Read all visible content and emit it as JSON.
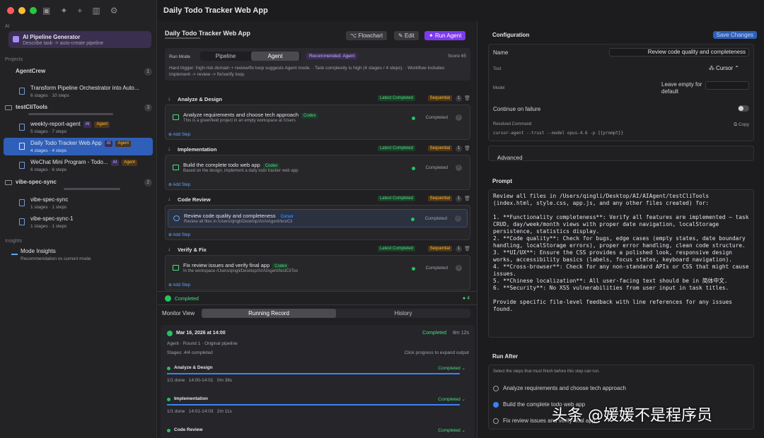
{
  "window": {
    "title": "Daily Todo Tracker Web App"
  },
  "sidebar": {
    "ai_label": "AI",
    "pipeline_generator": {
      "title": "AI Pipeline Generator",
      "subtitle": "Describe task -> auto-create pipeline"
    },
    "projects_label": "Projects",
    "groups": [
      {
        "name": "AgentCrew",
        "count": "1",
        "items": [
          {
            "title": "Transform Pipeline Orchestrator into Auto...",
            "meta": "6 stages · 10 steps"
          }
        ]
      },
      {
        "name": "testCliTools",
        "count": "3",
        "items": [
          {
            "title": "weekly-report-agent",
            "meta": "5 stages · 7 steps",
            "tags": [
              "AI",
              "Agent"
            ]
          },
          {
            "title": "Daily Todo Tracker Web App",
            "meta": "4 stages · 4 steps",
            "tags": [
              "AI",
              "Agent"
            ]
          },
          {
            "title": "WeChat Mini Program - Todo...",
            "meta": "6 stages · 6 steps",
            "tags": [
              "AI",
              "Agent"
            ]
          }
        ]
      },
      {
        "name": "vibe-spec-sync",
        "count": "2",
        "items": [
          {
            "title": "vibe-spec-sync",
            "meta": "1 stages · 1 steps"
          },
          {
            "title": "vibe-spec-sync-1",
            "meta": "1 stages · 1 steps"
          }
        ]
      }
    ],
    "insights_label": "Insights",
    "mode_insights": {
      "title": "Mode Insights",
      "subtitle": "Recommendation vs current mode"
    }
  },
  "center": {
    "title": "Daily Todo Tracker Web App",
    "buttons": {
      "flowchart": "Flowchart",
      "edit": "Edit",
      "run_agent": "Run Agent"
    },
    "run_mode": {
      "label": "Run Mode",
      "pipeline": "Pipeline",
      "agent": "Agent",
      "recommended": "Recommended: Agent",
      "score": "Score 65",
      "hint": "Hard trigger: high-risk domain + review/fix loop suggests Agent mode. · Task complexity is high (4 stages / 4 steps). · Workflow includes implement -> review -> fix/verify loop."
    },
    "stage_tags": {
      "latest": "Latest Completed",
      "sequential": "Sequential",
      "count": "1"
    },
    "add_step": "Add Step",
    "status_completed": "Completed",
    "stages": [
      {
        "name": "Analyze & Design",
        "step_title": "Analyze requirements and choose tech approach",
        "tool": "Codex",
        "desc": "This is a greenfield project in an empty workspace at /Users"
      },
      {
        "name": "Implementation",
        "step_title": "Build the complete todo web app",
        "tool": "Codex",
        "desc": "Based on the design, implement a daily todo tracker web app"
      },
      {
        "name": "Code Review",
        "step_title": "Review code quality and completeness",
        "tool": "Cursor",
        "desc": "Review all files in /Users/qingli/Desktop/AI/AIAgent/testCli"
      },
      {
        "name": "Verify & Fix",
        "step_title": "Fix review issues and verify final app",
        "tool": "Codex",
        "desc": "In the workspace /Users/qingli/Desktop/AI/AIAgent/testCliToo"
      }
    ],
    "summary": {
      "status": "Completed",
      "count": "4"
    },
    "monitor": {
      "label": "Monitor View",
      "tab_running": "Running Record",
      "tab_history": "History"
    },
    "record": {
      "date": "Mar 16, 2026 at 14:00",
      "status": "Completed",
      "duration": "8m 12s",
      "meta": "Agent · Round 1 · Original pipeline",
      "stages": "Stages: 4/4 completed",
      "expand_hint": "Click progress to expand output",
      "rows": [
        {
          "name": "Analyze & Design",
          "status": "Completed",
          "done": "1/1 done",
          "time": "14:00-14:01",
          "dur": "0m 38s"
        },
        {
          "name": "Implementation",
          "status": "Completed",
          "done": "1/1 done",
          "time": "14:01-14:03",
          "dur": "2m 11s"
        },
        {
          "name": "Code Review",
          "status": "Completed"
        }
      ]
    }
  },
  "config": {
    "title": "Configuration",
    "save": "Save Changes",
    "name_label": "Name",
    "name_value": "Review code quality and completeness",
    "tool_label": "Tool",
    "tool_value": "Cursor",
    "model_label": "Model",
    "model_placeholder": "Leave empty for default",
    "continue_label": "Continue on failure",
    "resolved_label": "Resolved Command",
    "copy": "Copy",
    "resolved_cmd": "cursor-agent --trust --model opus-4.6 -p {{prompt}}",
    "advanced": "Advanced"
  },
  "prompt": {
    "title": "Prompt",
    "text": "Review all files in /Users/qingli/Desktop/AI/AIAgent/testCliTools (index.html, style.css, app.js, and any other files created) for:\n\n1. **Functionality completeness**: Verify all features are implemented — task CRUD, day/week/month views with proper date navigation, localStorage persistence, statistics display.\n2. **Code quality**: Check for bugs, edge cases (empty states, date boundary handling, localStorage errors), proper error handling, clean code structure.\n3. **UI/UX**: Ensure the CSS provides a polished look, responsive design works, accessibility basics (labels, focus states, keyboard navigation).\n4. **Cross-browser**: Check for any non-standard APIs or CSS that might cause issues.\n5. **Chinese localization**: All user-facing text should be in 简体中文.\n6. **Security**: No XSS vulnerabilities from user input in task titles.\n\nProvide specific file-level feedback with line references for any issues found."
  },
  "run_after": {
    "title": "Run After",
    "desc": "Select the steps that must finish before this step can run.",
    "options": [
      {
        "label": "Analyze requirements and choose tech approach",
        "checked": false
      },
      {
        "label": "Build the complete todo web app",
        "checked": true
      },
      {
        "label": "Fix review issues and verify final app",
        "checked": false
      }
    ]
  },
  "watermark": "头条 @媛媛不是程序员"
}
